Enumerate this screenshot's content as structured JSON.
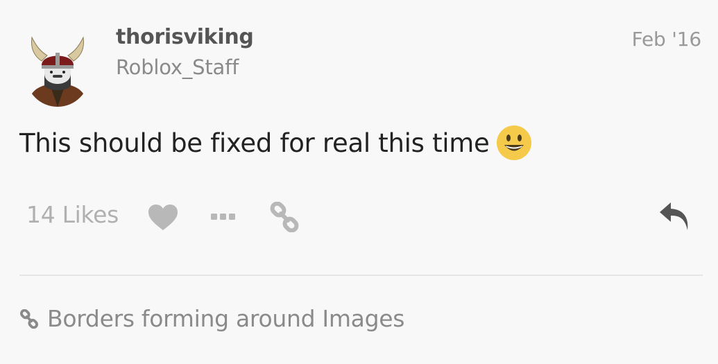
{
  "post": {
    "username": "thorisviking",
    "user_title": "Roblox_Staff",
    "date": "Feb '16",
    "body": "This should be fixed for real this time",
    "emoji": "smiley-emoji"
  },
  "actions": {
    "likes_label": "14 Likes",
    "icons": [
      "heart-icon",
      "ellipsis-icon",
      "link-icon",
      "reply-icon"
    ]
  },
  "linked_topic": {
    "title": "Borders forming around Images"
  },
  "colors": {
    "background": "#f8f8f8",
    "username": "#555555",
    "muted": "#8a8a8a",
    "icon_gray": "#b8b8b8",
    "reply_icon": "#555555",
    "emoji_yellow": "#f5c94a"
  }
}
